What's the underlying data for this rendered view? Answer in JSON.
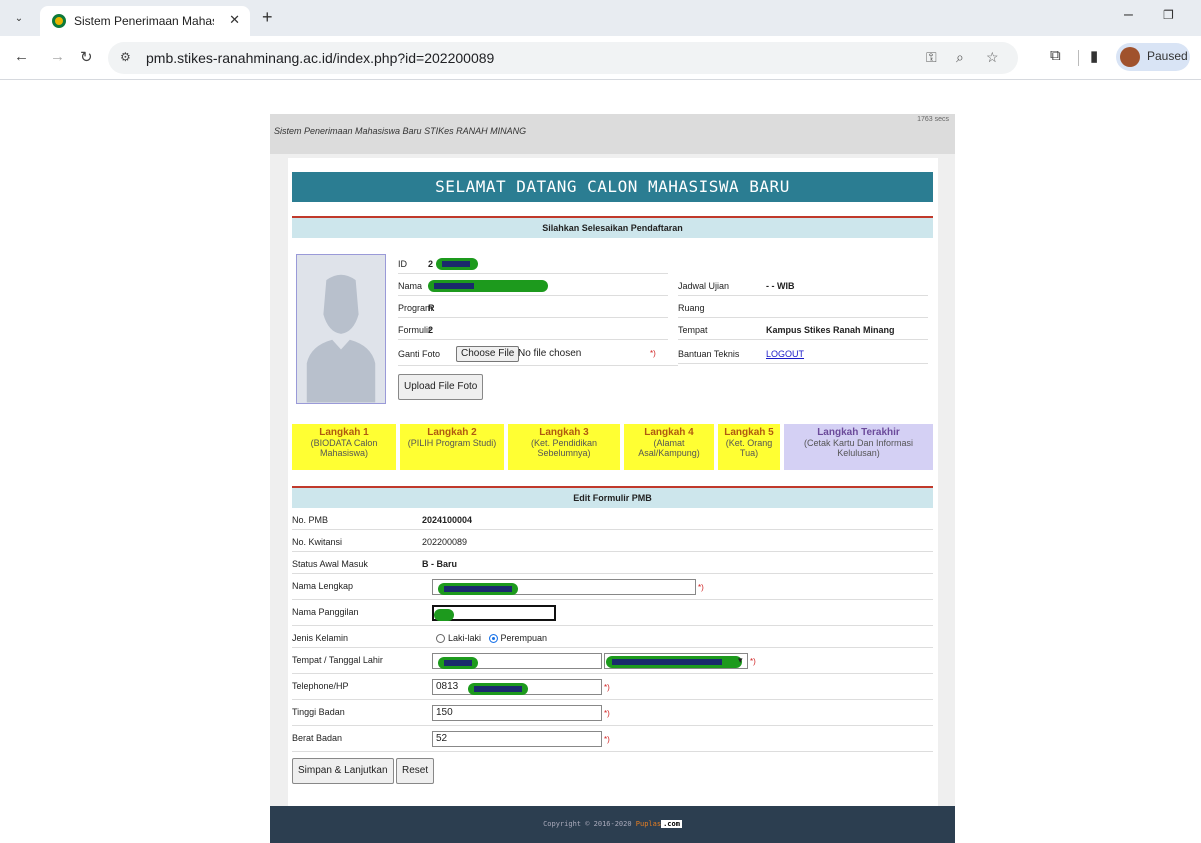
{
  "browser": {
    "tab_title": "Sistem Penerimaan Mahasiswa",
    "url": "pmb.stikes-ranahminang.ac.id/index.php?id=202200089",
    "profile_status": "Paused"
  },
  "page": {
    "header_title": "Sistem Penerimaan Mahasiswa Baru STIKes RANAH MINANG",
    "secs": "1763 secs",
    "welcome": "SELAMAT DATANG CALON MAHASISWA BARU",
    "section1_title": "Silahkan Selesaikan Pendaftaran",
    "info": {
      "id_label": "ID",
      "id_value": "2",
      "nama_label": "Nama",
      "nama_value": "",
      "program_label": "Program",
      "program_value": "R",
      "formulir_label": "Formulir",
      "formulir_value": "2",
      "ganti_foto_label": "Ganti Foto",
      "choose_file": "Choose File",
      "no_file": "No file chosen",
      "required_mark": "*)",
      "upload_btn": "Upload File Foto"
    },
    "info_right": {
      "jadwal_label": "Jadwal Ujian",
      "jadwal_value": "- - WIB",
      "ruang_label": "Ruang",
      "ruang_value": "",
      "tempat_label": "Tempat",
      "tempat_value": "Kampus Stikes Ranah Minang",
      "bantuan_label": "Bantuan Teknis",
      "logout": "LOGOUT"
    },
    "steps": [
      {
        "title": "Langkah 1",
        "desc": "(BIODATA Calon Mahasiswa)"
      },
      {
        "title": "Langkah 2",
        "desc": "(PILIH Program Studi)"
      },
      {
        "title": "Langkah 3",
        "desc": "(Ket. Pendidikan Sebelumnya)"
      },
      {
        "title": "Langkah 4",
        "desc": "(Alamat Asal/Kampung)"
      },
      {
        "title": "Langkah 5",
        "desc": "(Ket. Orang Tua)"
      },
      {
        "title": "Langkah Terakhir",
        "desc": "(Cetak Kartu Dan Informasi Kelulusan)"
      }
    ],
    "section2_title": "Edit Formulir PMB",
    "form": {
      "no_pmb_label": "No. PMB",
      "no_pmb_value": "2024100004",
      "kwitansi_label": "No. Kwitansi",
      "kwitansi_value": "202200089",
      "status_label": "Status Awal Masuk",
      "status_value": "B - Baru",
      "nama_lengkap_label": "Nama Lengkap",
      "nama_panggilan_label": "Nama Panggilan",
      "jenis_kelamin_label": "Jenis Kelamin",
      "laki_label": "Laki-laki",
      "perempuan_label": "Perempuan",
      "ttl_label": "Tempat / Tanggal Lahir",
      "telp_label": "Telephone/HP",
      "telp_value": "0813",
      "tinggi_label": "Tinggi Badan",
      "tinggi_value": "150",
      "berat_label": "Berat Badan",
      "berat_value": "52",
      "required_mark": "*)",
      "submit_btn": "Simpan & Lanjutkan",
      "reset_btn": "Reset"
    },
    "footer": {
      "text": "Copyright © 2016-2020 ",
      "brand": "Puplas",
      "brand_suffix": ".com"
    }
  }
}
